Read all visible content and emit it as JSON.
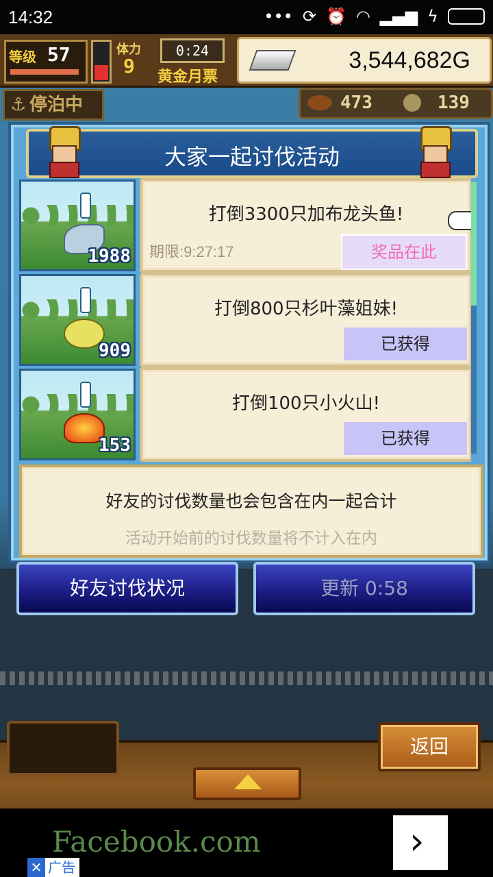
{
  "status_bar": {
    "time": "14:32",
    "icons": [
      "more-dots-icon",
      "sync-icon",
      "alarm-icon",
      "wifi-icon",
      "signal-icon",
      "signal-icon",
      "charging-icon",
      "battery-icon"
    ]
  },
  "hud": {
    "level_label": "等级",
    "level": "57",
    "stamina_label": "体力",
    "stamina": "9",
    "timer": "0:24",
    "gold_ticket": "黄金月票",
    "money": "3,544,682G",
    "moored": "停泊中",
    "resource_1": "473",
    "resource_2": "139"
  },
  "panel": {
    "title": "大家一起讨伐活动",
    "quests": [
      {
        "title": "打倒3300只加布龙头鱼!",
        "count": "1988",
        "deadline": "期限:9:27:17",
        "button": "奖品在此"
      },
      {
        "title": "打倒800只杉叶藻姐妹!",
        "count": "909",
        "button": "已获得"
      },
      {
        "title": "打倒100只小火山!",
        "count": "153",
        "button": "已获得"
      }
    ],
    "info_main": "好友的讨伐数量也会包含在内一起合计",
    "info_sub": "活动开始前的讨伐数量将不计入在内"
  },
  "buttons": {
    "friends_status": "好友讨伐状况",
    "refresh": "更新 0:58",
    "back": "返回"
  },
  "ad": {
    "text": "Facebook.com",
    "label": "广告",
    "close": "✕",
    "arrow": "›"
  }
}
